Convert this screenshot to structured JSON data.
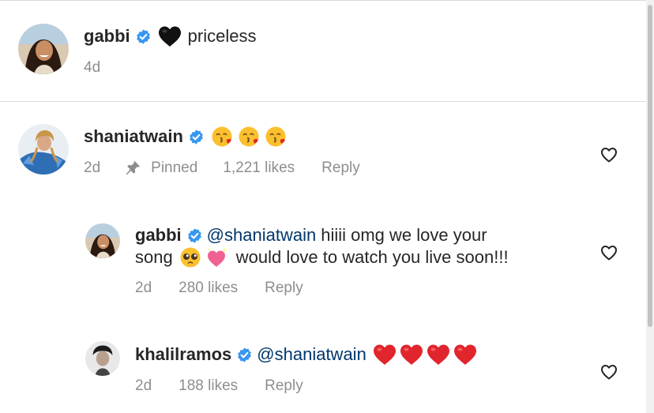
{
  "caption": {
    "username": "gabbi",
    "emoji": "🖤",
    "text": "priceless",
    "time": "4d"
  },
  "comments": [
    {
      "username": "shaniatwain",
      "emojis": [
        "😘",
        "😘",
        "😘"
      ],
      "time": "2d",
      "pinned_label": "Pinned",
      "likes": "1,221 likes",
      "reply_label": "Reply"
    },
    {
      "username": "gabbi",
      "mention": "@shaniatwain",
      "text_line1": "hiiii omg we love your",
      "text_line2_start": "song",
      "emojis": [
        "🥺",
        "💖"
      ],
      "text_line2_end": "would love to watch you live soon!!!",
      "time": "2d",
      "likes": "280 likes",
      "reply_label": "Reply"
    },
    {
      "username": "khalilramos",
      "mention": "@shaniatwain",
      "emojis": [
        "❤️",
        "❤️",
        "❤️",
        "❤️"
      ],
      "time": "2d",
      "likes": "188 likes",
      "reply_label": "Reply"
    }
  ],
  "icons": {
    "verified": "verified-badge-icon",
    "pin": "pin-icon",
    "like": "heart-outline-icon"
  },
  "colors": {
    "text": "#262626",
    "secondary": "#8e8e8e",
    "mention": "#00376b",
    "verified": "#3897f0",
    "divider": "#dbdbdb"
  }
}
